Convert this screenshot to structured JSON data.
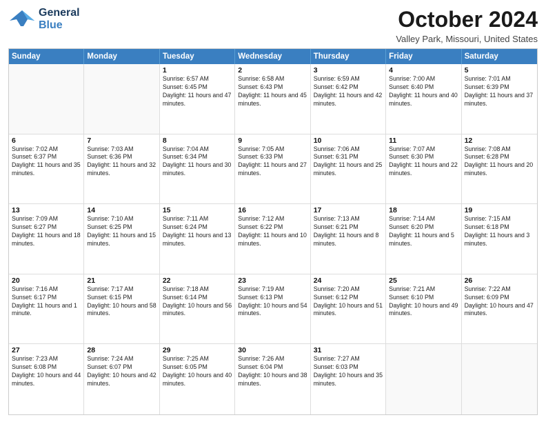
{
  "header": {
    "logo_general": "General",
    "logo_blue": "Blue",
    "month_title": "October 2024",
    "location": "Valley Park, Missouri, United States"
  },
  "days_of_week": [
    "Sunday",
    "Monday",
    "Tuesday",
    "Wednesday",
    "Thursday",
    "Friday",
    "Saturday"
  ],
  "weeks": [
    [
      {
        "day": "",
        "text": ""
      },
      {
        "day": "",
        "text": ""
      },
      {
        "day": "1",
        "text": "Sunrise: 6:57 AM\nSunset: 6:45 PM\nDaylight: 11 hours and 47 minutes."
      },
      {
        "day": "2",
        "text": "Sunrise: 6:58 AM\nSunset: 6:43 PM\nDaylight: 11 hours and 45 minutes."
      },
      {
        "day": "3",
        "text": "Sunrise: 6:59 AM\nSunset: 6:42 PM\nDaylight: 11 hours and 42 minutes."
      },
      {
        "day": "4",
        "text": "Sunrise: 7:00 AM\nSunset: 6:40 PM\nDaylight: 11 hours and 40 minutes."
      },
      {
        "day": "5",
        "text": "Sunrise: 7:01 AM\nSunset: 6:39 PM\nDaylight: 11 hours and 37 minutes."
      }
    ],
    [
      {
        "day": "6",
        "text": "Sunrise: 7:02 AM\nSunset: 6:37 PM\nDaylight: 11 hours and 35 minutes."
      },
      {
        "day": "7",
        "text": "Sunrise: 7:03 AM\nSunset: 6:36 PM\nDaylight: 11 hours and 32 minutes."
      },
      {
        "day": "8",
        "text": "Sunrise: 7:04 AM\nSunset: 6:34 PM\nDaylight: 11 hours and 30 minutes."
      },
      {
        "day": "9",
        "text": "Sunrise: 7:05 AM\nSunset: 6:33 PM\nDaylight: 11 hours and 27 minutes."
      },
      {
        "day": "10",
        "text": "Sunrise: 7:06 AM\nSunset: 6:31 PM\nDaylight: 11 hours and 25 minutes."
      },
      {
        "day": "11",
        "text": "Sunrise: 7:07 AM\nSunset: 6:30 PM\nDaylight: 11 hours and 22 minutes."
      },
      {
        "day": "12",
        "text": "Sunrise: 7:08 AM\nSunset: 6:28 PM\nDaylight: 11 hours and 20 minutes."
      }
    ],
    [
      {
        "day": "13",
        "text": "Sunrise: 7:09 AM\nSunset: 6:27 PM\nDaylight: 11 hours and 18 minutes."
      },
      {
        "day": "14",
        "text": "Sunrise: 7:10 AM\nSunset: 6:25 PM\nDaylight: 11 hours and 15 minutes."
      },
      {
        "day": "15",
        "text": "Sunrise: 7:11 AM\nSunset: 6:24 PM\nDaylight: 11 hours and 13 minutes."
      },
      {
        "day": "16",
        "text": "Sunrise: 7:12 AM\nSunset: 6:22 PM\nDaylight: 11 hours and 10 minutes."
      },
      {
        "day": "17",
        "text": "Sunrise: 7:13 AM\nSunset: 6:21 PM\nDaylight: 11 hours and 8 minutes."
      },
      {
        "day": "18",
        "text": "Sunrise: 7:14 AM\nSunset: 6:20 PM\nDaylight: 11 hours and 5 minutes."
      },
      {
        "day": "19",
        "text": "Sunrise: 7:15 AM\nSunset: 6:18 PM\nDaylight: 11 hours and 3 minutes."
      }
    ],
    [
      {
        "day": "20",
        "text": "Sunrise: 7:16 AM\nSunset: 6:17 PM\nDaylight: 11 hours and 1 minute."
      },
      {
        "day": "21",
        "text": "Sunrise: 7:17 AM\nSunset: 6:15 PM\nDaylight: 10 hours and 58 minutes."
      },
      {
        "day": "22",
        "text": "Sunrise: 7:18 AM\nSunset: 6:14 PM\nDaylight: 10 hours and 56 minutes."
      },
      {
        "day": "23",
        "text": "Sunrise: 7:19 AM\nSunset: 6:13 PM\nDaylight: 10 hours and 54 minutes."
      },
      {
        "day": "24",
        "text": "Sunrise: 7:20 AM\nSunset: 6:12 PM\nDaylight: 10 hours and 51 minutes."
      },
      {
        "day": "25",
        "text": "Sunrise: 7:21 AM\nSunset: 6:10 PM\nDaylight: 10 hours and 49 minutes."
      },
      {
        "day": "26",
        "text": "Sunrise: 7:22 AM\nSunset: 6:09 PM\nDaylight: 10 hours and 47 minutes."
      }
    ],
    [
      {
        "day": "27",
        "text": "Sunrise: 7:23 AM\nSunset: 6:08 PM\nDaylight: 10 hours and 44 minutes."
      },
      {
        "day": "28",
        "text": "Sunrise: 7:24 AM\nSunset: 6:07 PM\nDaylight: 10 hours and 42 minutes."
      },
      {
        "day": "29",
        "text": "Sunrise: 7:25 AM\nSunset: 6:05 PM\nDaylight: 10 hours and 40 minutes."
      },
      {
        "day": "30",
        "text": "Sunrise: 7:26 AM\nSunset: 6:04 PM\nDaylight: 10 hours and 38 minutes."
      },
      {
        "day": "31",
        "text": "Sunrise: 7:27 AM\nSunset: 6:03 PM\nDaylight: 10 hours and 35 minutes."
      },
      {
        "day": "",
        "text": ""
      },
      {
        "day": "",
        "text": ""
      }
    ]
  ]
}
